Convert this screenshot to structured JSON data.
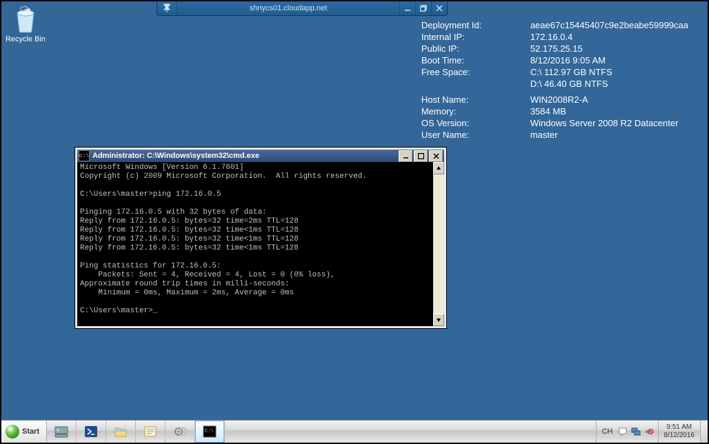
{
  "desktop": {
    "recycle_bin_label": "Recycle Bin"
  },
  "rdp": {
    "host": "shnycs01.cloudapp.net"
  },
  "info": {
    "rows1": [
      {
        "k": "Deployment Id:",
        "v": "aeae67c15445407c9e2beabe59999caa"
      },
      {
        "k": "Internal IP:",
        "v": "172.16.0.4"
      },
      {
        "k": "Public IP:",
        "v": "52.175.25.15"
      },
      {
        "k": "Boot Time:",
        "v": "8/12/2016 9:05 AM"
      },
      {
        "k": "Free Space:",
        "v": "C:\\ 112.97 GB NTFS\nD:\\ 46.40 GB NTFS"
      }
    ],
    "rows2": [
      {
        "k": "Host Name:",
        "v": "WIN2008R2-A"
      },
      {
        "k": "Memory:",
        "v": "3584 MB"
      },
      {
        "k": "OS Version:",
        "v": "Windows Server 2008 R2 Datacenter"
      },
      {
        "k": "User Name:",
        "v": "master"
      }
    ]
  },
  "cmd": {
    "title": "Administrator: C:\\Windows\\system32\\cmd.exe",
    "output": "Microsoft Windows [Version 6.1.7601]\nCopyright (c) 2009 Microsoft Corporation.  All rights reserved.\n\nC:\\Users\\master>ping 172.16.0.5\n\nPinging 172.16.0.5 with 32 bytes of data:\nReply from 172.16.0.5: bytes=32 time=2ms TTL=128\nReply from 172.16.0.5: bytes=32 time<1ms TTL=128\nReply from 172.16.0.5: bytes=32 time<1ms TTL=128\nReply from 172.16.0.5: bytes=32 time<1ms TTL=128\n\nPing statistics for 172.16.0.5:\n    Packets: Sent = 4, Received = 4, Lost = 0 (0% loss),\nApproximate round trip times in milli-seconds:\n    Minimum = 0ms, Maximum = 2ms, Average = 0ms\n\nC:\\Users\\master>_"
  },
  "taskbar": {
    "start_label": "Start",
    "lang": "CH",
    "time": "9:51 AM",
    "date": "8/12/2016"
  }
}
